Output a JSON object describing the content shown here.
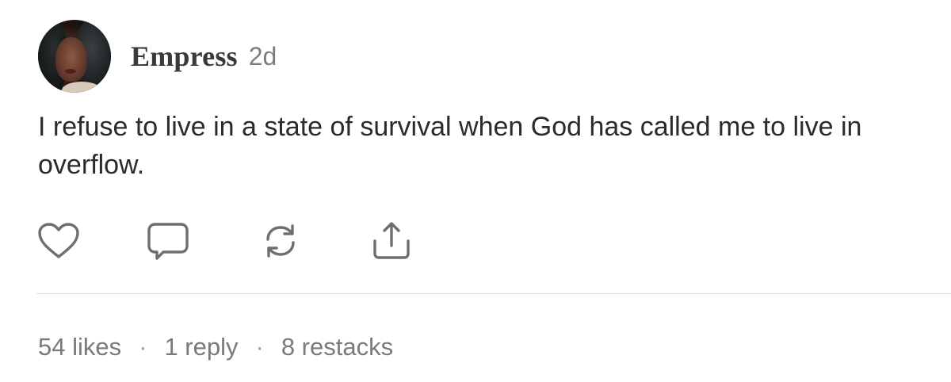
{
  "post": {
    "author": {
      "name": "Empress",
      "time_ago": "2d"
    },
    "text": "I refuse to live in a state of survival when God has called me to live in overflow.",
    "actions": [
      {
        "icon": "heart-icon"
      },
      {
        "icon": "comment-icon"
      },
      {
        "icon": "restack-icon"
      },
      {
        "icon": "share-icon"
      }
    ],
    "stats": {
      "likes": "54 likes",
      "replies": "1 reply",
      "restacks": "8 restacks",
      "separator": "·"
    }
  },
  "colors": {
    "icon": "#6e6e6e",
    "text": "#2b2b2b",
    "muted": "#7a7a7a",
    "divider": "#dcdcdc"
  }
}
